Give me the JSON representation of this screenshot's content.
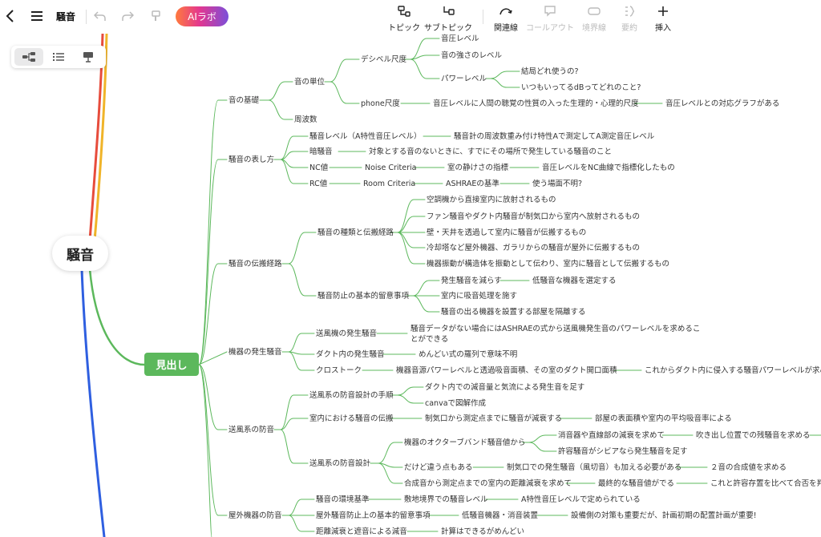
{
  "toolbar": {
    "title": "騒音",
    "ai_label": "AIラボ",
    "tools": [
      {
        "label": "トピック",
        "disabled": false
      },
      {
        "label": "サブトピック",
        "disabled": false
      },
      {
        "label": "関連線",
        "disabled": false
      },
      {
        "label": "コールアウト",
        "disabled": true
      },
      {
        "label": "境界線",
        "disabled": true
      },
      {
        "label": "要約",
        "disabled": true
      },
      {
        "label": "挿入",
        "disabled": false
      }
    ]
  },
  "mindmap": {
    "root": "騒音",
    "main_topic": "見出し",
    "branch_color": "#5cb85c",
    "other_branch_colors": [
      "#e74c3c",
      "#f0b429",
      "#2f5fe0"
    ],
    "topics": {
      "t1": "音の基礎",
      "t2": "騒音の表し方",
      "t3": "騒音の伝搬経路",
      "t4": "機器の発生騒音",
      "t5": "送風系の防音",
      "t6": "屋外機器の防音"
    },
    "nodes": {
      "a1": "音の単位",
      "a2": "周波数",
      "a3": "デシベル尺度",
      "a4": "phone尺度",
      "a5": "音圧レベル",
      "a6": "音の強さのレベル",
      "a7": "パワーレベル",
      "a8": "結局どれ使うの?",
      "a9": "いつもいってるdBってどれのこと?",
      "a10": "音圧レベルに人間の聴覚の性質の入った生理的・心理的尺度",
      "a11": "音圧レベルとの対応グラフがある",
      "b1": "騒音レベル（A特性音圧レベル）",
      "b2": "騒音計の周波数重み付け特性Aで測定してA測定音圧レベル",
      "b3": "暗騒音",
      "b4": "対象とする音のないときに、すでにその場所で発生している騒音のこと",
      "b5": "NC値",
      "b6": "Noise Criteria",
      "b7": "室の静けさの指標",
      "b8": "音圧レベルをNC曲線で指標化したもの",
      "b9": "RC値",
      "b10": "Room Criteria",
      "b11": "ASHRAEの基準",
      "b12": "使う場面不明?",
      "c1": "騒音の種類と伝搬経路",
      "c2": "空調機から直接室内に放射されるもの",
      "c3": "ファン騒音やダクト内騒音が制気口から室内へ放射されるもの",
      "c4": "壁・天井を透過して室内に騒音が伝搬するもの",
      "c5": "冷却塔など屋外機器、ガラリからの騒音が屋外に伝搬するもの",
      "c6": "機器振動が構造体を振動として伝わり、室内に騒音として伝搬するもの",
      "c7": "騒音防止の基本的留意事項",
      "c8": "発生騒音を減らす",
      "c9": "低騒音な機器を選定する",
      "c10": "室内に吸音処理を施す",
      "c11": "騒音の出る機器を設置する部屋を隔離する",
      "d1": "送風機の発生騒音",
      "d2": "騒音データがない場合にはASHRAEの式から送風機発生音のパワーレベルを求めるこ",
      "d2b": "とができる",
      "d3": "ダクト内の発生騒音",
      "d4": "めんどい式の羅列で意味不明",
      "d5": "クロストーク",
      "d6": "機器音源パワーレベルと透過吸音面積、その室のダクト開口面積",
      "d7": "これからダクト内に侵入する騒音パワーレベルが求め",
      "e1": "送風系の防音設計の手順",
      "e2": "ダクト内での減音量と気流による発生音を足す",
      "e3": "canvaで図解作成",
      "e4": "室内における騒音の伝搬",
      "e5": "制気口から測定点までに騒音が減衰する",
      "e6": "部屋の表面積や室内の平均吸音率による",
      "e7": "送風系の防音設計",
      "e8": "機器のオクターブバンド騒音値から",
      "e9": "消音器や直線部の減衰を求めて",
      "e10": "吹き出し位置での残騒音を求める",
      "e11": "許容騒音がシビアなら発生騒音を足す",
      "e12": "だけど違う点もある",
      "e13": "制気口での発生騒音（風切音）も加える必要がある",
      "e14": "２音の合成値を求める",
      "e15": "合成音から測定点までの室内の距離減衰を求めて",
      "e16": "最終的な騒音値がでる",
      "e17": "これと許容存置を比べて合否を判",
      "f1": "騒音の環境基準",
      "f2": "敷地境界での騒音レベル",
      "f3": "A特性音圧レベルで定められている",
      "f4": "屋外騒音防止上の基本的留意事項",
      "f5": "低騒音機器・消音装置",
      "f6": "設備側の対策も重要だが、計画初期の配置計画が重要!",
      "f7": "距離減衰と遮音による減音",
      "f8": "計算はできるがめんどい"
    }
  }
}
